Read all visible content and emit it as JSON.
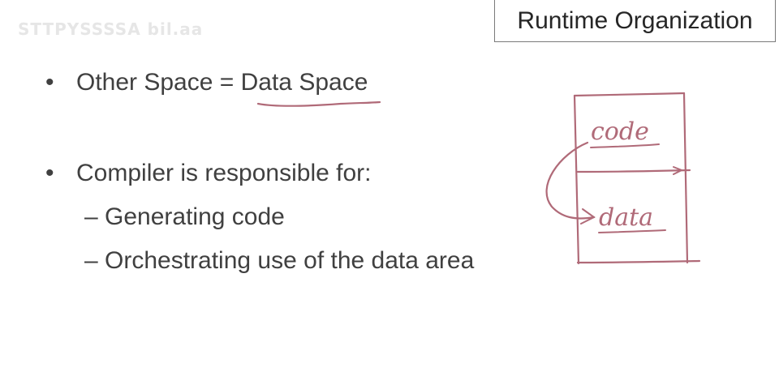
{
  "watermark": "STTPYSSSSA bil.aa",
  "title": "Runtime Organization",
  "bullets": [
    {
      "text": "Other Space = Data Space"
    },
    {
      "text": "Compiler is responsible for:"
    }
  ],
  "sub_bullets": [
    {
      "text": "– Generating code"
    },
    {
      "text": "– Orchestrating use of the data area"
    }
  ],
  "annotation": {
    "code_label": "code",
    "data_label": "data",
    "ink_color": "#b06a78"
  }
}
